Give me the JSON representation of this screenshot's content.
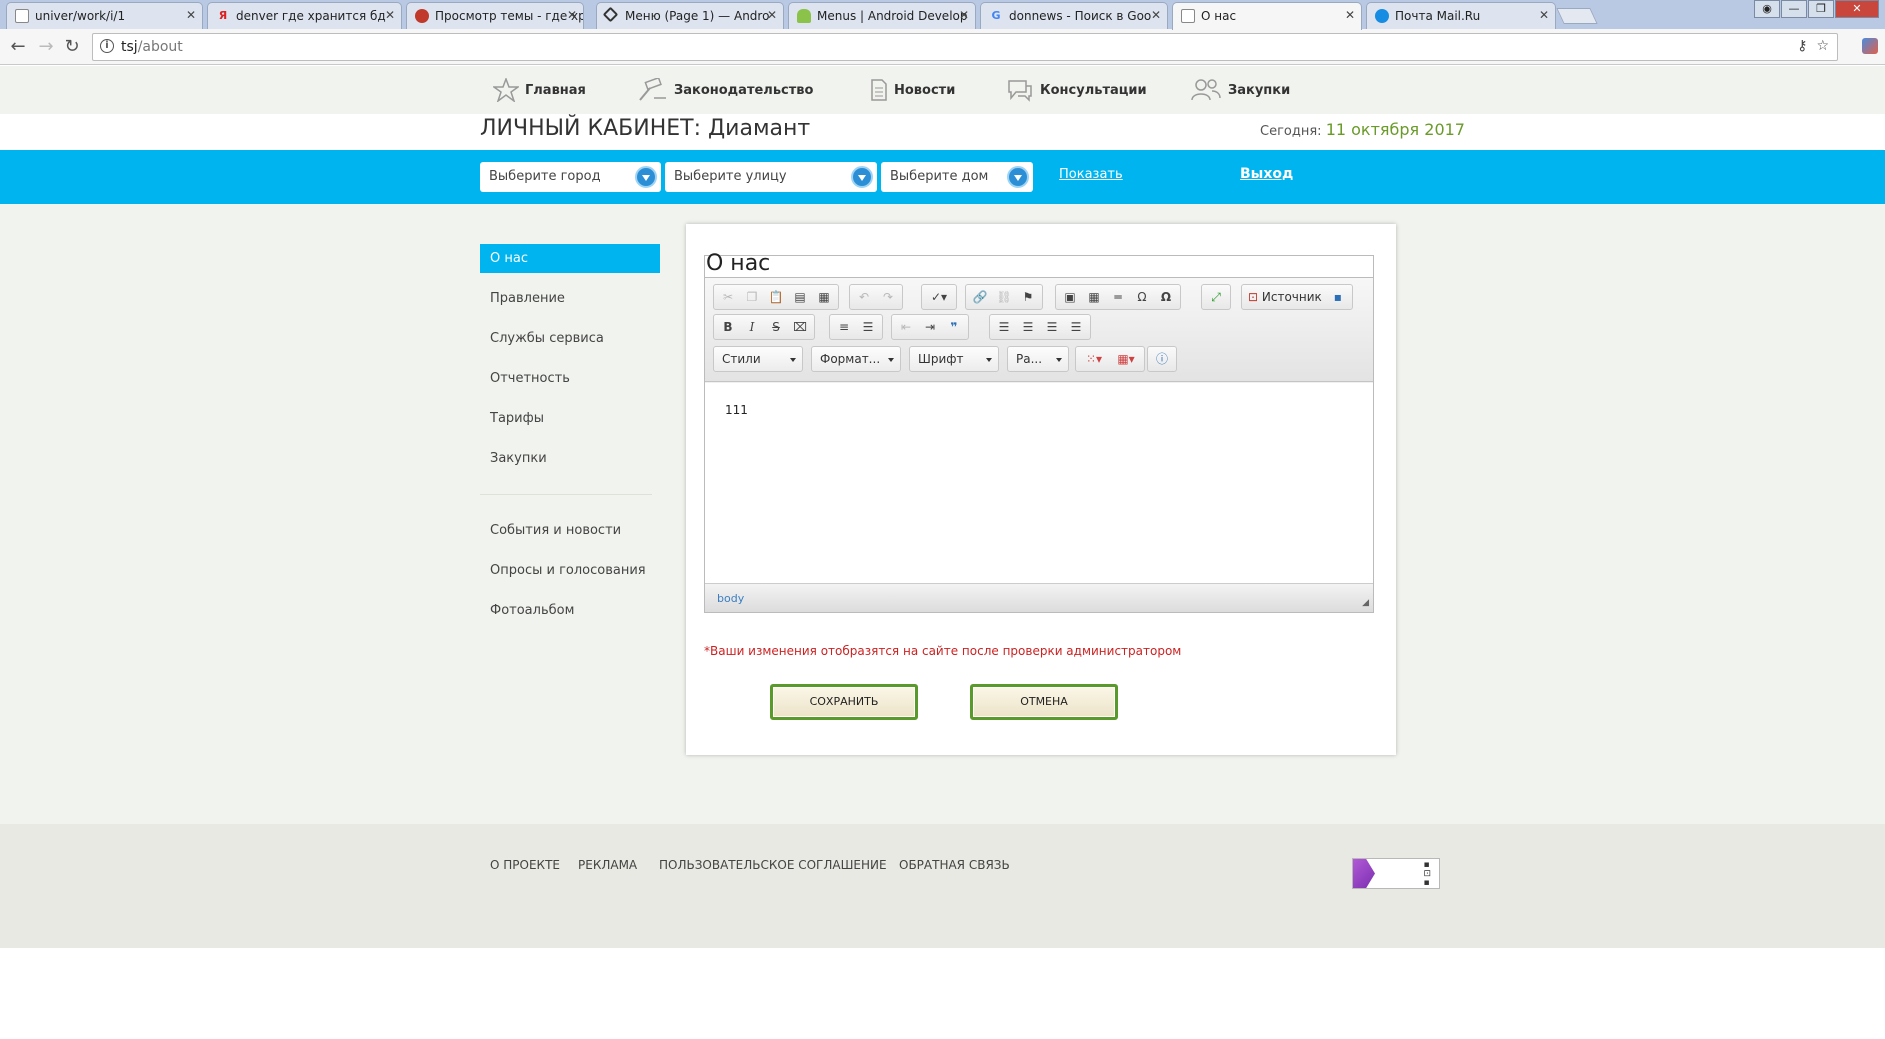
{
  "browser": {
    "tabs": [
      {
        "title": "univer/work/i/1",
        "favicon": "page-icon",
        "active": false
      },
      {
        "title": "denver где хранится бд",
        "favicon": "yandex-icon",
        "active": false
      },
      {
        "title": "Просмотр темы - где хр",
        "favicon": "forum-icon",
        "active": false
      },
      {
        "title": "Меню (Page 1) — Andro",
        "favicon": "menu-site-icon",
        "active": false
      },
      {
        "title": "Menus | Android Develop",
        "favicon": "android-icon",
        "active": false
      },
      {
        "title": "donnews - Поиск в Goo",
        "favicon": "google-icon",
        "active": false
      },
      {
        "title": "О нас",
        "favicon": "page-icon",
        "active": true
      },
      {
        "title": "Почта Mail.Ru",
        "favicon": "mailru-icon",
        "active": false
      }
    ],
    "url_host": "tsj",
    "url_path": "/about"
  },
  "topnav": {
    "items": [
      {
        "label": "Главная",
        "icon": "star-icon"
      },
      {
        "label": "Законодательство",
        "icon": "gavel-icon"
      },
      {
        "label": "Новости",
        "icon": "document-icon"
      },
      {
        "label": "Консультации",
        "icon": "chat-icon"
      },
      {
        "label": "Закупки",
        "icon": "people-icon"
      }
    ]
  },
  "header": {
    "cabinet_title": "ЛИЧНЫЙ КАБИНЕТ: Диамант",
    "today_label": "Сегодня:",
    "today_date": "11 октября 2017"
  },
  "filters": {
    "city_placeholder": "Выберите город",
    "street_placeholder": "Выберите улицу",
    "house_placeholder": "Выберите дом",
    "show_label": "Показать",
    "exit_label": "Выход",
    "accent_color": "#00b4f0"
  },
  "sidebar": {
    "items": [
      {
        "label": "О нас",
        "active": true
      },
      {
        "label": "Правление",
        "active": false
      },
      {
        "label": "Службы сервиса",
        "active": false
      },
      {
        "label": "Отчетность",
        "active": false
      },
      {
        "label": "Тарифы",
        "active": false
      },
      {
        "label": "Закупки",
        "active": false
      }
    ],
    "secondary_items": [
      {
        "label": "События и новости"
      },
      {
        "label": "Опросы и голосования"
      },
      {
        "label": "Фотоальбом"
      }
    ]
  },
  "editor": {
    "title": "О нас",
    "source_label": "Источник",
    "combos": {
      "styles": "Стили",
      "format": "Формат...",
      "font": "Шрифт",
      "size": "Ра..."
    },
    "body_text": "111",
    "status_path": "body"
  },
  "form": {
    "note": "*Ваши изменения отобразятся на сайте после проверки администратором",
    "save_label": "СОХРАНИТЬ",
    "cancel_label": "ОТМЕНА"
  },
  "footer": {
    "links": [
      "О ПРОЕКТЕ",
      "РЕКЛАМА",
      "ПОЛЬЗОВАТЕЛЬСКОЕ СОГЛАШЕНИЕ",
      "ОБРАТНАЯ СВЯЗЬ"
    ]
  }
}
